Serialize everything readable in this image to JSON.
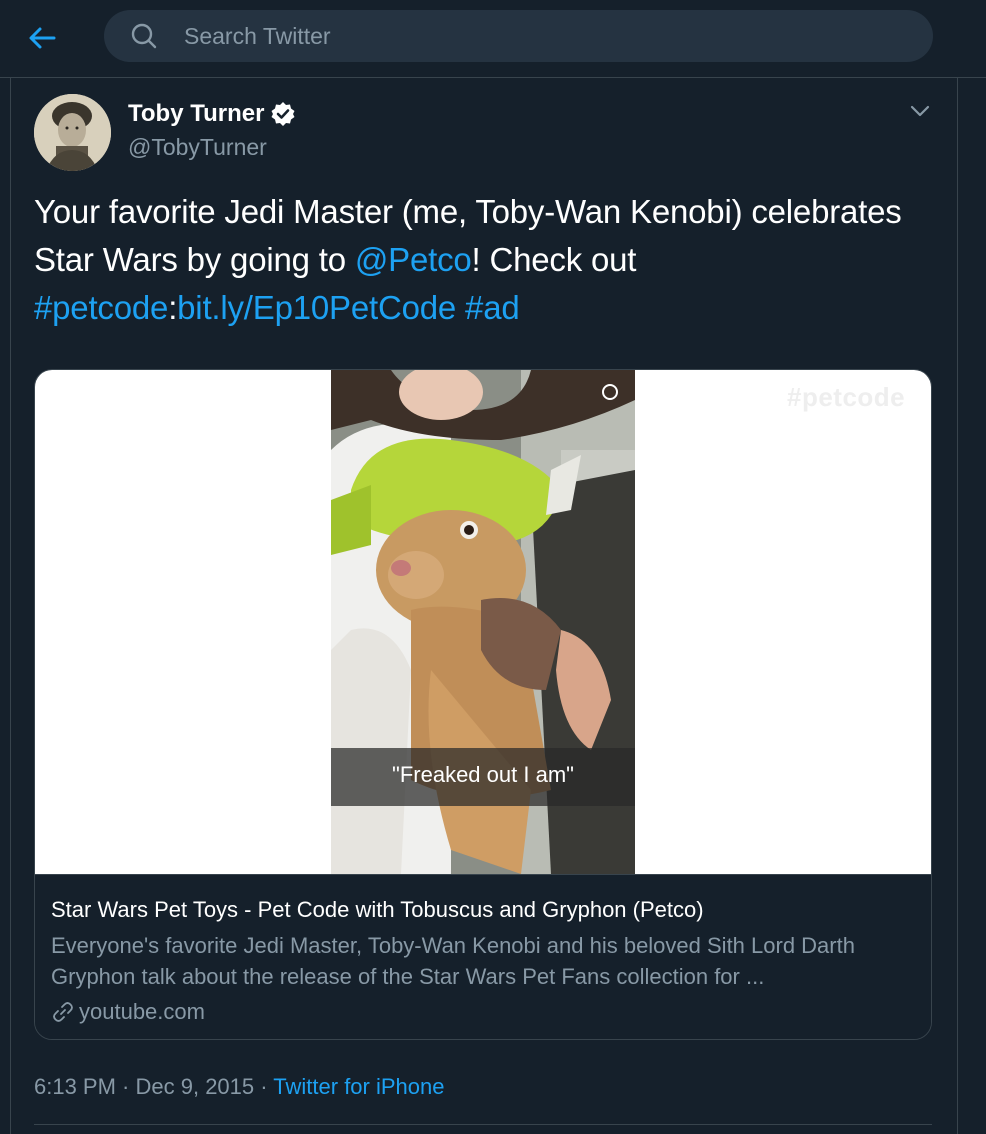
{
  "header": {
    "search_placeholder": "Search Twitter",
    "accent_color": "#1da1f2",
    "background_color": "#15202b"
  },
  "tweet": {
    "author_name": "Toby Turner",
    "author_handle": "@TobyTurner",
    "verified": true,
    "text": {
      "part1": "Your favorite Jedi Master (me, Toby-Wan Kenobi) celebrates Star Wars by going to ",
      "mention": "@Petco",
      "part2": "! Check out ",
      "hashtag1": "#petcode",
      "colon": ":",
      "link": "bit.ly/Ep10PetCode",
      "space": " ",
      "hashtag2": "#ad"
    },
    "card": {
      "watermark": "#petcode",
      "video_caption": "\"Freaked out I am\"",
      "title": "Star Wars Pet Toys - Pet Code with Tobuscus and Gryphon (Petco)",
      "description": "Everyone's favorite Jedi Master, Toby-Wan Kenobi and his beloved Sith Lord Darth Gryphon talk about the release of the Star Wars Pet Fans collection for ...",
      "domain": "youtube.com"
    },
    "time": "6:13 PM",
    "separator1": " · ",
    "date": "Dec 9, 2015",
    "separator2": " · ",
    "source": "Twitter for iPhone"
  }
}
